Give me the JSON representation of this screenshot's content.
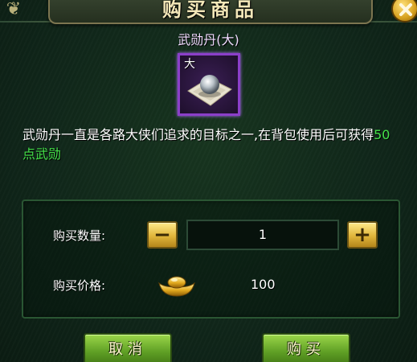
{
  "dialog": {
    "title": "购买商品",
    "close_icon": "close-icon"
  },
  "item": {
    "name": "武勋丹(大)",
    "badge": "大",
    "icon": "pearl-on-paper-icon",
    "border_color": "#8b3fc9"
  },
  "description": {
    "text_before": "武勋丹一直是各路大侠们追求的目标之一,在背包使用后可获得",
    "highlight": "50点武勋",
    "highlight_color": "#45e24a"
  },
  "purchase": {
    "quantity_label": "购买数量:",
    "decrease_label": "−",
    "quantity_value": "1",
    "increase_label": "+",
    "price_label": "购买价格:",
    "currency_icon": "gold-ingot-icon",
    "price_value": "100"
  },
  "buttons": {
    "cancel_label": "取消",
    "buy_label": "购买"
  }
}
